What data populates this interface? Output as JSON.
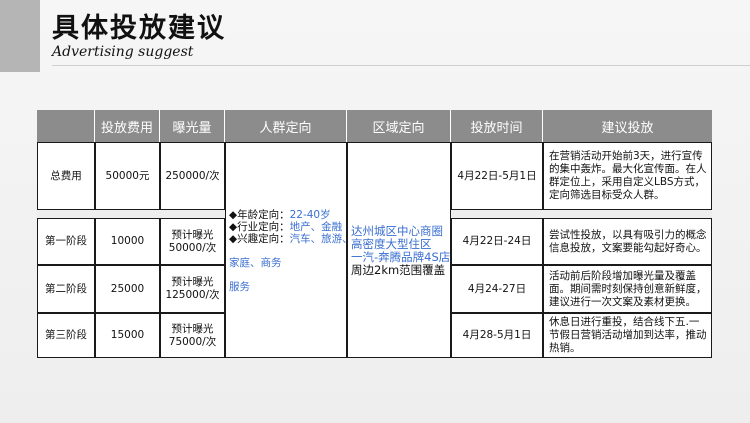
{
  "header": {
    "title_cn": "具体投放建议",
    "title_en": "Advertising suggest"
  },
  "table": {
    "columns": [
      "",
      "投放费用",
      "曝光量",
      "人群定向",
      "区域定向",
      "投放时间",
      "建议投放"
    ],
    "rows": [
      {
        "label": "总费用",
        "cost": "50000元",
        "exposure": "250000/次",
        "time": "4月22日-5月1日",
        "suggest": "在营销活动开始前3天，进行宣传的集中轰炸。最大化宣传面。在人群定位上，采用自定义LBS方式，定向筛选目标受众人群。"
      },
      {
        "label": "第一阶段",
        "cost": "10000",
        "exposure": "预计曝光50000/次",
        "time": "4月22日-24日",
        "suggest": "尝试性投放，以具有吸引力的概念信息投放，文案要能勾起好奇心。"
      },
      {
        "label": "第二阶段",
        "cost": "25000",
        "exposure": "预计曝光125000/次",
        "time": "4月24-27日",
        "suggest": "活动前后阶段增加曝光量及覆盖面。期间需时刻保持创意新鲜度，建议进行一次文案及素材更换。"
      },
      {
        "label": "第三阶段",
        "cost": "15000",
        "exposure": "预计曝光75000/次",
        "time": "4月28-5月1日",
        "suggest": "休息日进行重投，结合线下五.一节假日营销活动增加到达率，推动热销。"
      }
    ],
    "crowd": {
      "age_label": "◆年龄定向：",
      "age_value": "22-40岁",
      "industry_label": "◆行业定向：",
      "industry_value": "地产、金融",
      "interest_label": "◆兴趣定向：",
      "interest_value": "汽车、旅游、",
      "interest_more1": "家庭、商务",
      "interest_more2": "服务"
    },
    "region": {
      "line1": "达州城区中心商圈",
      "line2": "高密度大型住区",
      "line3": "一汽-奔腾品牌4S店",
      "line4": "周边2km范围覆盖"
    }
  },
  "colors": {
    "header_bg": "#8c8c8c",
    "accent_blue": "#3a6fd0",
    "corner_block": "#b5b5b5"
  }
}
